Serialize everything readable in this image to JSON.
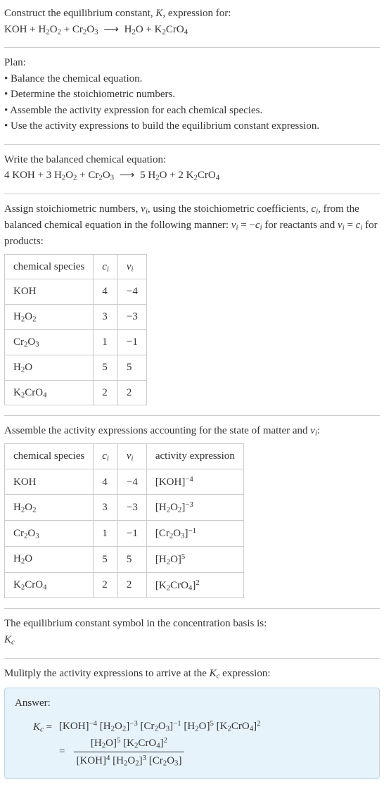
{
  "intro": {
    "line1": "Construct the equilibrium constant, <i>K</i>, expression for:",
    "equation": "KOH + H<sub>2</sub>O<sub>2</sub> + Cr<sub>2</sub>O<sub>3</sub> <span class='arrow'>⟶</span> H<sub>2</sub>O + K<sub>2</sub>CrO<sub>4</sub>"
  },
  "plan": {
    "heading": "Plan:",
    "items": [
      "• Balance the chemical equation.",
      "• Determine the stoichiometric numbers.",
      "• Assemble the activity expression for each chemical species.",
      "• Use the activity expressions to build the equilibrium constant expression."
    ]
  },
  "balanced": {
    "heading": "Write the balanced chemical equation:",
    "equation": "4 KOH + 3 H<sub>2</sub>O<sub>2</sub> + Cr<sub>2</sub>O<sub>3</sub> <span class='arrow'>⟶</span> 5 H<sub>2</sub>O + 2 K<sub>2</sub>CrO<sub>4</sub>"
  },
  "stoich": {
    "heading": "Assign stoichiometric numbers, <i>ν<sub>i</sub></i>, using the stoichiometric coefficients, <i>c<sub>i</sub></i>, from the balanced chemical equation in the following manner: <i>ν<sub>i</sub></i> = −<i>c<sub>i</sub></i> for reactants and <i>ν<sub>i</sub></i> = <i>c<sub>i</sub></i> for products:",
    "headers": [
      "chemical species",
      "<i>c<sub>i</sub></i>",
      "<i>ν<sub>i</sub></i>"
    ],
    "rows": [
      [
        "KOH",
        "4",
        "−4"
      ],
      [
        "H<sub>2</sub>O<sub>2</sub>",
        "3",
        "−3"
      ],
      [
        "Cr<sub>2</sub>O<sub>3</sub>",
        "1",
        "−1"
      ],
      [
        "H<sub>2</sub>O",
        "5",
        "5"
      ],
      [
        "K<sub>2</sub>CrO<sub>4</sub>",
        "2",
        "2"
      ]
    ]
  },
  "activity": {
    "heading": "Assemble the activity expressions accounting for the state of matter and <i>ν<sub>i</sub></i>:",
    "headers": [
      "chemical species",
      "<i>c<sub>i</sub></i>",
      "<i>ν<sub>i</sub></i>",
      "activity expression"
    ],
    "rows": [
      [
        "KOH",
        "4",
        "−4",
        "[KOH]<sup>−4</sup>"
      ],
      [
        "H<sub>2</sub>O<sub>2</sub>",
        "3",
        "−3",
        "[H<sub>2</sub>O<sub>2</sub>]<sup>−3</sup>"
      ],
      [
        "Cr<sub>2</sub>O<sub>3</sub>",
        "1",
        "−1",
        "[Cr<sub>2</sub>O<sub>3</sub>]<sup>−1</sup>"
      ],
      [
        "H<sub>2</sub>O",
        "5",
        "5",
        "[H<sub>2</sub>O]<sup>5</sup>"
      ],
      [
        "K<sub>2</sub>CrO<sub>4</sub>",
        "2",
        "2",
        "[K<sub>2</sub>CrO<sub>4</sub>]<sup>2</sup>"
      ]
    ]
  },
  "symbol": {
    "heading": "The equilibrium constant symbol in the concentration basis is:",
    "value": "<i>K<sub>c</sub></i>"
  },
  "multiply": {
    "heading": "Mulitply the activity expressions to arrive at the <i>K<sub>c</sub></i> expression:"
  },
  "answer": {
    "label": "Answer:",
    "kc": "<i>K<sub>c</sub></i> =",
    "line1": "[KOH]<sup>−4</sup> [H<sub>2</sub>O<sub>2</sub>]<sup>−3</sup> [Cr<sub>2</sub>O<sub>3</sub>]<sup>−1</sup> [H<sub>2</sub>O]<sup>5</sup> [K<sub>2</sub>CrO<sub>4</sub>]<sup>2</sup>",
    "frac_num": "[H<sub>2</sub>O]<sup>5</sup> [K<sub>2</sub>CrO<sub>4</sub>]<sup>2</sup>",
    "frac_den": "[KOH]<sup>4</sup> [H<sub>2</sub>O<sub>2</sub>]<sup>3</sup> [Cr<sub>2</sub>O<sub>3</sub>]"
  },
  "chart_data": {
    "type": "table",
    "tables": [
      {
        "title": "stoichiometric numbers",
        "columns": [
          "chemical species",
          "c_i",
          "ν_i"
        ],
        "rows": [
          [
            "KOH",
            4,
            -4
          ],
          [
            "H2O2",
            3,
            -3
          ],
          [
            "Cr2O3",
            1,
            -1
          ],
          [
            "H2O",
            5,
            5
          ],
          [
            "K2CrO4",
            2,
            2
          ]
        ]
      },
      {
        "title": "activity expressions",
        "columns": [
          "chemical species",
          "c_i",
          "ν_i",
          "activity expression"
        ],
        "rows": [
          [
            "KOH",
            4,
            -4,
            "[KOH]^-4"
          ],
          [
            "H2O2",
            3,
            -3,
            "[H2O2]^-3"
          ],
          [
            "Cr2O3",
            1,
            -1,
            "[Cr2O3]^-1"
          ],
          [
            "H2O",
            5,
            5,
            "[H2O]^5"
          ],
          [
            "K2CrO4",
            2,
            2,
            "[K2CrO4]^2"
          ]
        ]
      }
    ]
  }
}
